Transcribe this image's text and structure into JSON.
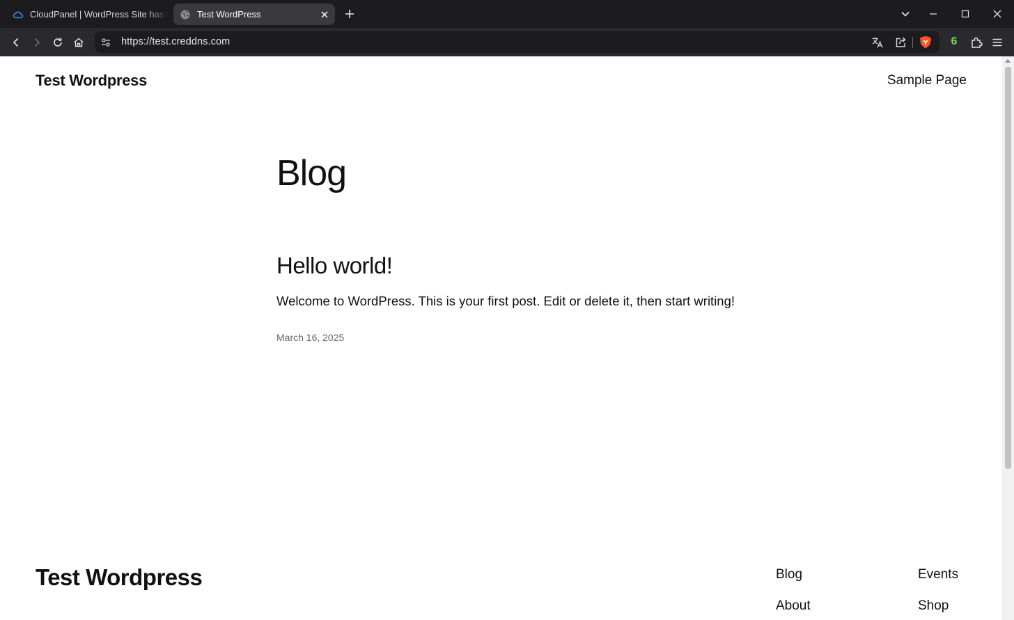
{
  "browser": {
    "tabs": [
      {
        "title": "CloudPanel | WordPress Site has b",
        "active": false,
        "favicon": "cloud-icon"
      },
      {
        "title": "Test WordPress",
        "active": true,
        "favicon": "globe-icon"
      }
    ],
    "url": "https://test.creddns.com",
    "extension_badge": "6",
    "colors": {
      "tabbar": "#1c1c1f",
      "toolbar": "#2a2a2e",
      "brave_accent": "#fb542b",
      "badge": "#7ed957"
    }
  },
  "site": {
    "title": "Test Wordpress",
    "nav": [
      "Sample Page"
    ]
  },
  "main": {
    "heading": "Blog",
    "posts": [
      {
        "title": "Hello world!",
        "excerpt": "Welcome to WordPress. This is your first post. Edit or delete it, then start writing!",
        "date": "March 16, 2025"
      }
    ]
  },
  "footer": {
    "title": "Test Wordpress",
    "links": [
      "Blog",
      "Events",
      "About",
      "Shop"
    ]
  }
}
